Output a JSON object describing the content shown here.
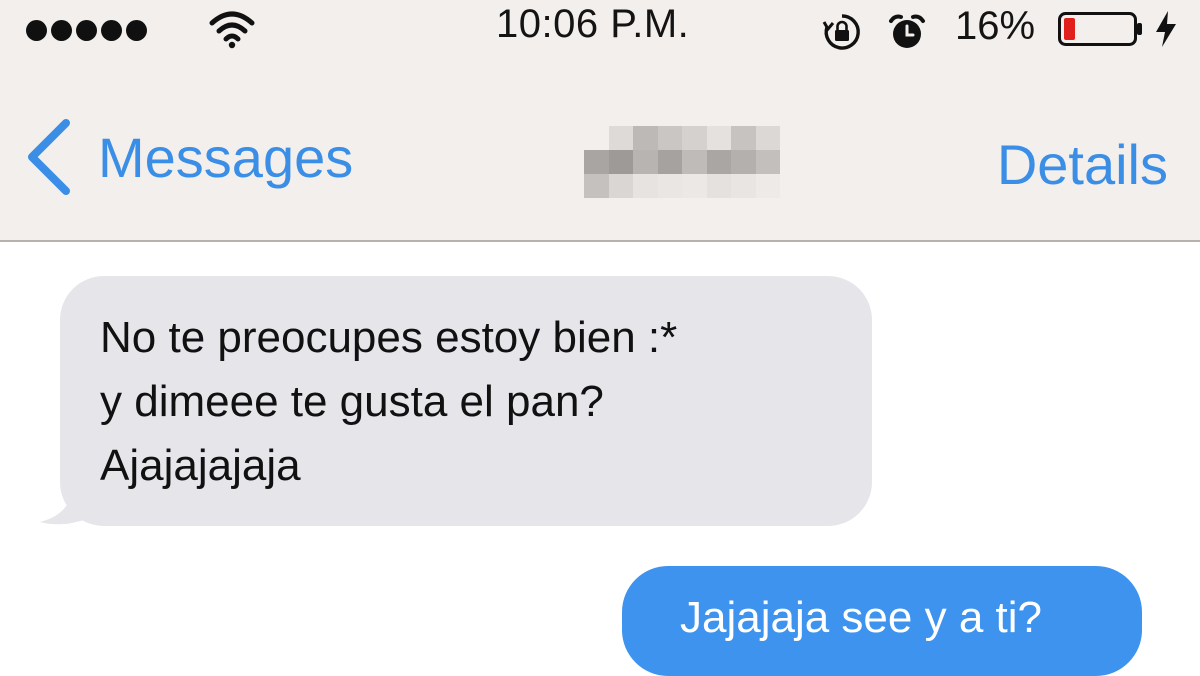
{
  "status_bar": {
    "time": "10:06 P.M.",
    "battery_percent": "16%",
    "battery_level": 0.16,
    "signal_bars": 5,
    "icons": [
      "signal-dots-icon",
      "wifi-icon",
      "rotation-lock-icon",
      "alarm-icon",
      "battery-icon",
      "charging-bolt-icon"
    ]
  },
  "nav": {
    "back_label": "Messages",
    "details_label": "Details",
    "contact_name_redacted": true
  },
  "messages": [
    {
      "direction": "incoming",
      "lines": [
        "No te preocupes estoy bien :*",
        "y dimeee te gusta el pan?",
        "Ajajajajaja"
      ]
    },
    {
      "direction": "outgoing",
      "text": "Jajajaja see y a ti?"
    }
  ],
  "colors": {
    "accent": "#3a8ee6",
    "incoming_bubble": "#e5e5ea",
    "outgoing_bubble": "#3d93ee",
    "nav_background": "#f3efec",
    "battery_low": "#e0211b"
  }
}
